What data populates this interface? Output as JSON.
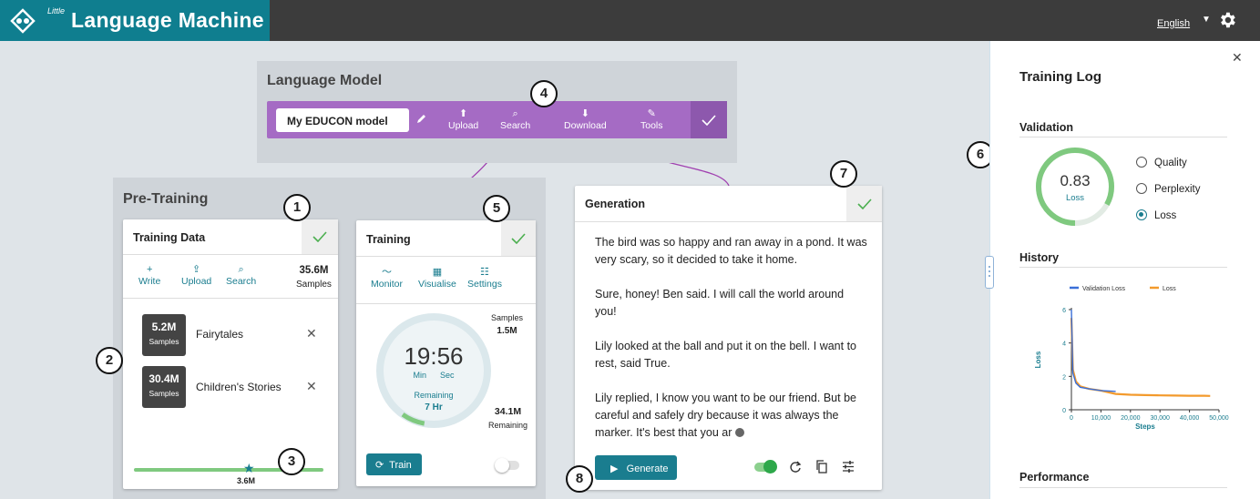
{
  "app": {
    "little": "Little",
    "title": "Language Machine",
    "language": "English",
    "language_caret": "▼"
  },
  "language_model": {
    "header": "Language Model",
    "model_name": "My EDUCON model",
    "toolbar": [
      {
        "label": "Upload",
        "icon": "upload-icon",
        "glyph": "⬆"
      },
      {
        "label": "Search",
        "icon": "search-icon",
        "glyph": "🔍"
      },
      {
        "label": "Download",
        "icon": "download-icon",
        "glyph": "⬇"
      },
      {
        "label": "Tools",
        "icon": "wrench-icon",
        "glyph": "🔧"
      }
    ]
  },
  "pretraining": {
    "header": "Pre-Training",
    "training_data": {
      "title": "Training Data",
      "tools": [
        {
          "label": "Write",
          "glyph": "+"
        },
        {
          "label": "Upload",
          "glyph": "⇪"
        },
        {
          "label": "Search",
          "glyph": "⌕"
        }
      ],
      "total_value": "35.6M",
      "total_unit": "Samples",
      "datasets": [
        {
          "value": "5.2M",
          "unit": "Samples",
          "name": "Fairytales",
          "remove": "✕"
        },
        {
          "value": "30.4M",
          "unit": "Samples",
          "name": "Children's Stories",
          "remove": "✕"
        }
      ],
      "slider_label": "3.6M",
      "slider_star": "★"
    },
    "training": {
      "title": "Training",
      "tools": [
        {
          "label": "Monitor",
          "glyph": "〜"
        },
        {
          "label": "Visualise",
          "glyph": "▦"
        },
        {
          "label": "Settings",
          "glyph": "☷"
        }
      ],
      "samples_label": "Samples",
      "samples_value": "1.5M",
      "time": "19:56",
      "min": "Min",
      "sec": "Sec",
      "remaining_label": "Remaining",
      "remaining_value": "7 Hr",
      "remaining_samples": "34.1M",
      "remaining_samples_label": "Remaining",
      "train_button": "Train",
      "train_icon": "⟳",
      "progress": 0.07
    }
  },
  "generation": {
    "title": "Generation",
    "paragraphs": [
      "The bird was so happy and ran away in a pond. It was very scary, so it decided to take it home.",
      "Sure, honey! Ben said. I will call the world around you!",
      "Lily looked at the ball and put it on the bell. I want to rest, said True.",
      "Lily replied, I know you want to be our friend. But be careful and safely dry because it was always the marker. It's best that you ar"
    ],
    "generate_button": "Generate",
    "generate_icon": "▶",
    "icons": [
      "refresh-icon",
      "copy-icon",
      "tune-icon"
    ]
  },
  "callouts": [
    "1",
    "2",
    "3",
    "4",
    "5",
    "6",
    "7",
    "8"
  ],
  "sidebar": {
    "close": "✕",
    "title": "Training Log",
    "validation": {
      "header": "Validation",
      "value": "0.83",
      "label": "Loss",
      "gauge_fraction": 0.83,
      "options": [
        {
          "label": "Quality",
          "selected": false
        },
        {
          "label": "Perplexity",
          "selected": false
        },
        {
          "label": "Loss",
          "selected": true
        }
      ]
    },
    "history_header": "History",
    "performance_header": "Performance"
  },
  "chart_data": {
    "type": "line",
    "xlabel": "Steps",
    "ylabel": "Loss",
    "xlim": [
      0,
      50000
    ],
    "ylim": [
      0,
      6
    ],
    "x_ticks": [
      "0",
      "10,000",
      "20,000",
      "30,000",
      "40,000",
      "50,000"
    ],
    "y_ticks": [
      "0",
      "2",
      "4",
      "6"
    ],
    "legend": "top",
    "series": [
      {
        "name": "Validation Loss",
        "color": "#3a6fd8",
        "x": [
          0,
          500,
          1500,
          3000,
          6000,
          10000,
          15000
        ],
        "y": [
          6.0,
          2.2,
          1.6,
          1.35,
          1.25,
          1.15,
          1.1
        ]
      },
      {
        "name": "Loss",
        "color": "#f39a2c",
        "x": [
          0,
          500,
          1500,
          3000,
          6000,
          10000,
          15000,
          20000,
          25000,
          30000,
          35000,
          40000,
          45000,
          47000
        ],
        "y": [
          5.5,
          2.4,
          1.7,
          1.4,
          1.25,
          1.15,
          0.95,
          0.9,
          0.88,
          0.86,
          0.85,
          0.84,
          0.84,
          0.83
        ]
      }
    ]
  },
  "colors": {
    "brand": "#0f7e8f",
    "purple": "#a56bc4",
    "teal": "#1a7d8f",
    "green": "#4caf50"
  }
}
